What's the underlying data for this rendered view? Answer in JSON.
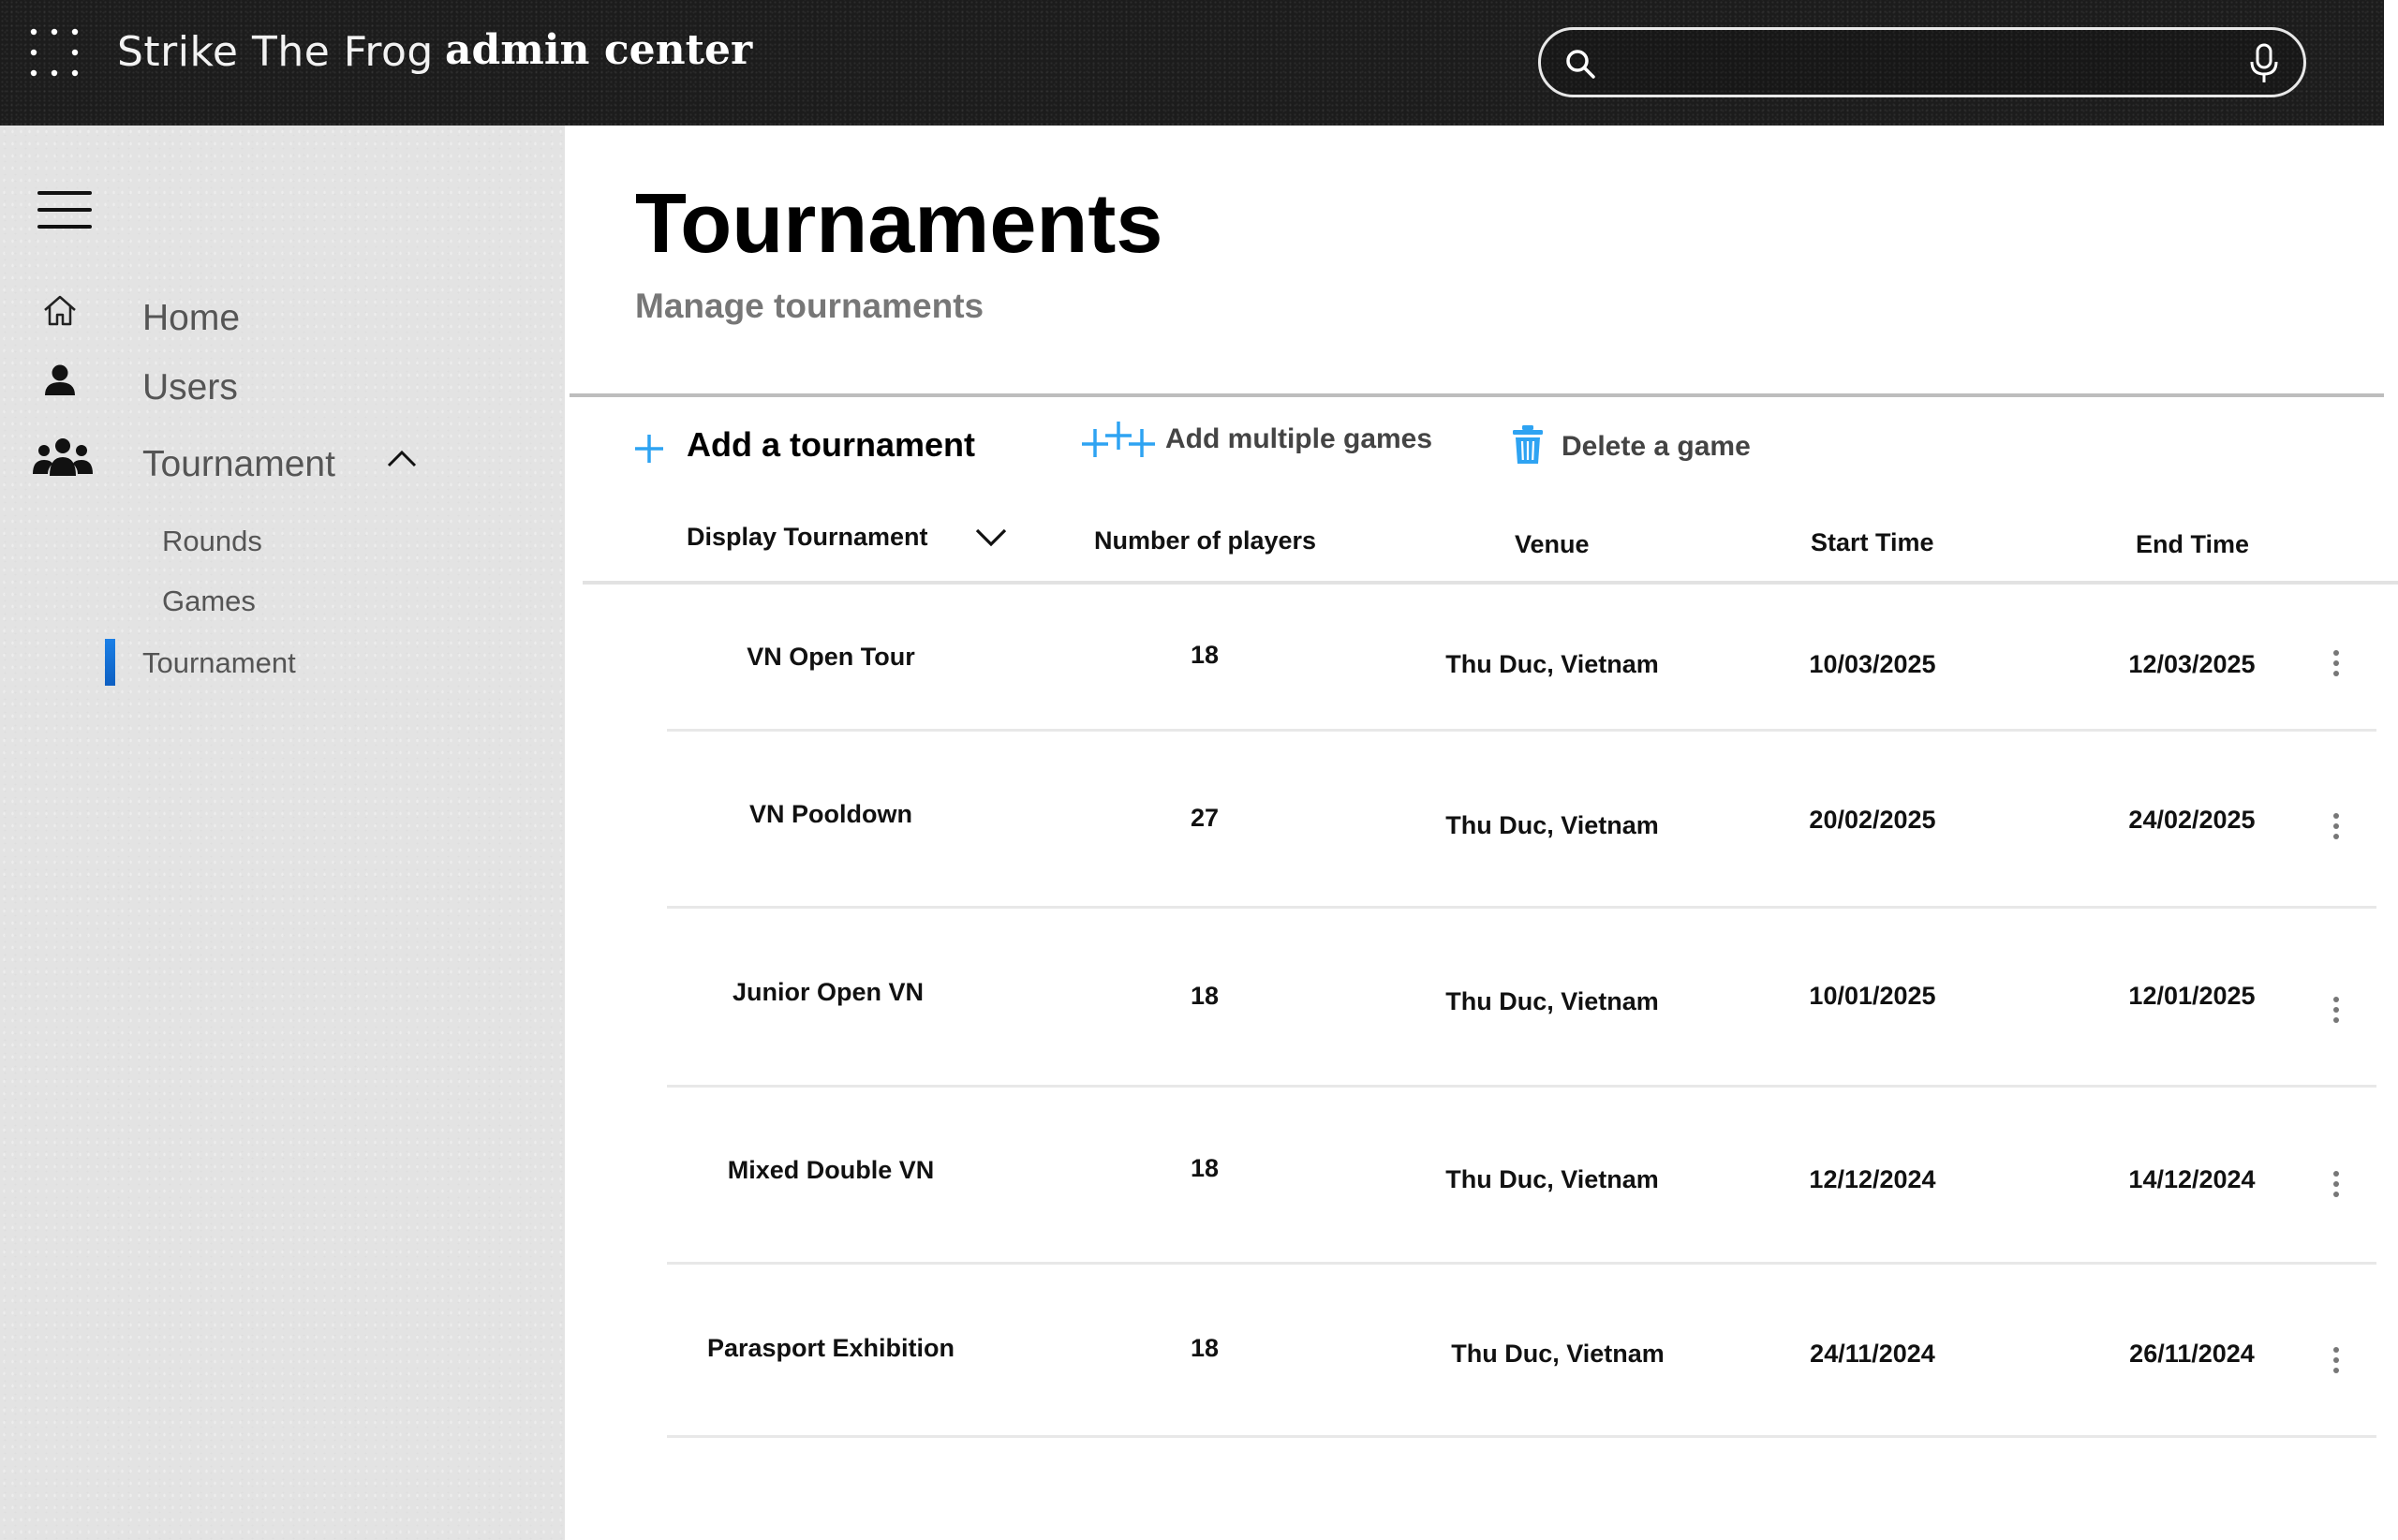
{
  "header": {
    "app_name": "Strike The Frog",
    "app_section": "admin center",
    "search": {
      "value": "",
      "placeholder": ""
    },
    "icons": [
      "waffle-icon",
      "search-icon",
      "mic-icon"
    ]
  },
  "sidebar": {
    "menu_icon": "hamburger-icon",
    "items": [
      {
        "label": "Home",
        "icon": "home-icon"
      },
      {
        "label": "Users",
        "icon": "user-icon"
      },
      {
        "label": "Tournament",
        "icon": "group-icon",
        "expanded": true
      }
    ],
    "sub_items": [
      {
        "label": "Rounds"
      },
      {
        "label": "Games"
      },
      {
        "label": "Tournament",
        "active": true
      }
    ]
  },
  "main": {
    "title": "Tournaments",
    "subtitle": "Manage tournaments",
    "actions": {
      "add_tournament": "Add a tournament",
      "add_multiple_games": "Add multiple games",
      "delete_game": "Delete a game"
    },
    "columns": {
      "display": "Display Tournament",
      "players": "Number of players",
      "venue": "Venue",
      "start": "Start Time",
      "end": "End Time"
    },
    "rows": [
      {
        "name": "VN Open Tour",
        "players": "18",
        "venue": "Thu Duc, Vietnam",
        "start": "10/03/2025",
        "end": "12/03/2025"
      },
      {
        "name": "VN Pooldown",
        "players": "27",
        "venue": "Thu Duc, Vietnam",
        "start": "20/02/2025",
        "end": "24/02/2025"
      },
      {
        "name": "Junior Open VN",
        "players": "18",
        "venue": "Thu Duc, Vietnam",
        "start": "10/01/2025",
        "end": "12/01/2025"
      },
      {
        "name": "Mixed Double VN",
        "players": "18",
        "venue": "Thu Duc, Vietnam",
        "start": "12/12/2024",
        "end": "14/12/2024"
      },
      {
        "name": "Parasport Exhibition",
        "players": "18",
        "venue": "Thu Duc, Vietnam",
        "start": "24/11/2024",
        "end": "26/11/2024"
      }
    ]
  },
  "colors": {
    "accent": "#2ea3f2",
    "topbar": "#1c1c1c",
    "sidebar": "#e3e3e3",
    "active_indicator": "#1a7fe6"
  }
}
